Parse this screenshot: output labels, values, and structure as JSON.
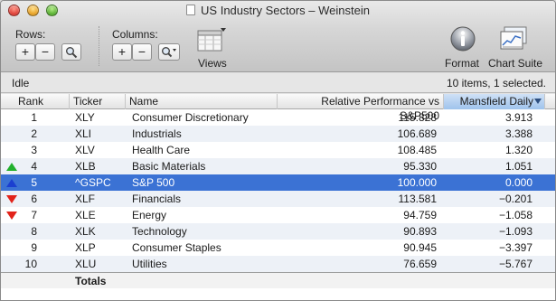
{
  "window": {
    "title": "US Industry Sectors – Weinstein"
  },
  "toolbar": {
    "rows_label": "Rows:",
    "columns_label": "Columns:",
    "views_label": "Views",
    "format_label": "Format",
    "chart_suite_label": "Chart Suite",
    "add_glyph": "+",
    "remove_glyph": "−"
  },
  "status": {
    "left": "Idle",
    "right": "10 items, 1 selected."
  },
  "table": {
    "headers": {
      "rank": "Rank",
      "ticker": "Ticker",
      "name": "Name",
      "relperf": "Relative Performance vs S&P500",
      "mansfield": "Mansfield Daily"
    },
    "rows": [
      {
        "rank": "1",
        "ticker": "XLY",
        "name": "Consumer Discretionary",
        "relperf": "115.828",
        "mansfield": "3.913",
        "indicator": ""
      },
      {
        "rank": "2",
        "ticker": "XLI",
        "name": "Industrials",
        "relperf": "106.689",
        "mansfield": "3.388",
        "indicator": ""
      },
      {
        "rank": "3",
        "ticker": "XLV",
        "name": "Health Care",
        "relperf": "108.485",
        "mansfield": "1.320",
        "indicator": ""
      },
      {
        "rank": "4",
        "ticker": "XLB",
        "name": "Basic Materials",
        "relperf": "95.330",
        "mansfield": "1.051",
        "indicator": "up-green"
      },
      {
        "rank": "5",
        "ticker": "^GSPC",
        "name": "S&P 500",
        "relperf": "100.000",
        "mansfield": "0.000",
        "indicator": "up-blue"
      },
      {
        "rank": "6",
        "ticker": "XLF",
        "name": "Financials",
        "relperf": "113.581",
        "mansfield": "−0.201",
        "indicator": "down-red"
      },
      {
        "rank": "7",
        "ticker": "XLE",
        "name": "Energy",
        "relperf": "94.759",
        "mansfield": "−1.058",
        "indicator": "down-red"
      },
      {
        "rank": "8",
        "ticker": "XLK",
        "name": "Technology",
        "relperf": "90.893",
        "mansfield": "−1.093",
        "indicator": ""
      },
      {
        "rank": "9",
        "ticker": "XLP",
        "name": "Consumer Staples",
        "relperf": "90.945",
        "mansfield": "−3.397",
        "indicator": ""
      },
      {
        "rank": "10",
        "ticker": "XLU",
        "name": "Utilities",
        "relperf": "76.659",
        "mansfield": "−5.767",
        "indicator": ""
      }
    ],
    "selected_rank": "5",
    "totals_label": "Totals"
  },
  "colors": {
    "selection": "#3b72d4",
    "up_green": "#22b02d",
    "up_blue": "#1b3fd0",
    "down_red": "#e2231a",
    "sorted_header": "#9fc3ec"
  },
  "icons": {
    "rows_search": "magnifier-icon",
    "columns_search": "magnifier-dropdown-icon",
    "views": "views-table-icon",
    "format": "info-icon",
    "chart_suite": "chart-suite-icon"
  }
}
